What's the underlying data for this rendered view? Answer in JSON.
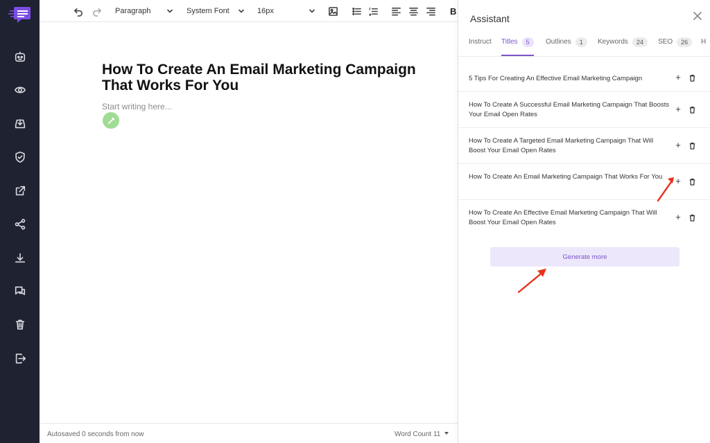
{
  "toolbar": {
    "block_type": "Paragraph",
    "font_family": "System Font",
    "font_size": "16px",
    "bold_label": "B"
  },
  "editor": {
    "title": "How To Create An Email Marketing Campaign That Works For You",
    "placeholder": "Start writing here..."
  },
  "footer": {
    "autosave": "Autosaved 0 seconds from now",
    "word_count": "Word Count 11"
  },
  "assistant": {
    "title": "Assistant",
    "tabs": [
      {
        "label": "Instruct",
        "count": ""
      },
      {
        "label": "Titles",
        "count": "5"
      },
      {
        "label": "Outlines",
        "count": "1"
      },
      {
        "label": "Keywords",
        "count": "24"
      },
      {
        "label": "SEO",
        "count": "26"
      },
      {
        "label": "H",
        "count": ""
      }
    ],
    "active_tab": "Titles",
    "titles": [
      "5 Tips For Creating An Effective Email Marketing Campaign",
      "How To Create A Successful Email Marketing Campaign That Boosts Your Email Open Rates",
      "How To Create A Targeted Email Marketing Campaign That Will Boost Your Email Open Rates",
      "How To Create An Email Marketing Campaign That Works For You",
      "How To Create An Effective Email Marketing Campaign That Will Boost Your Email Open Rates"
    ],
    "generate_label": "Generate more"
  },
  "colors": {
    "rail_bg": "#1f2230",
    "accent": "#7b53c9",
    "generate_bg": "#ece7fb",
    "annotation_arrow": "#e8321e",
    "pen_bg": "#9fdc94"
  },
  "icons": {
    "rail": [
      "logo-icon",
      "robot-icon",
      "eye-icon",
      "inbox-download-icon",
      "shield-check-icon",
      "external-link-icon",
      "share-icon",
      "download-icon",
      "chat-icon",
      "trash-icon",
      "logout-icon"
    ]
  }
}
